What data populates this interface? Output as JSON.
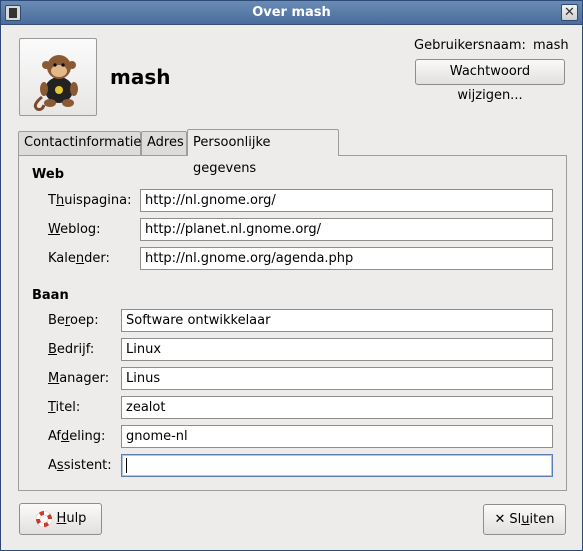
{
  "window": {
    "title": "Over mash"
  },
  "header": {
    "display_name": "mash",
    "username_label": "Gebruikersnaam:",
    "username_value": "mash",
    "change_password_label": "Wachtwoord wijzigen..."
  },
  "tabs": [
    {
      "label": "Contactinformatie",
      "active": false
    },
    {
      "label": "Adres",
      "active": false
    },
    {
      "label": "Persoonlijke gegevens",
      "active": true
    }
  ],
  "web": {
    "section_title": "Web",
    "fields": [
      {
        "pre": "T",
        "u": "h",
        "post": "uispagina:",
        "value": "http://nl.gnome.org/"
      },
      {
        "pre": "",
        "u": "W",
        "post": "eblog:",
        "value": "http://planet.nl.gnome.org/"
      },
      {
        "pre": "Kale",
        "u": "n",
        "post": "der:",
        "value": "http://nl.gnome.org/agenda.php"
      }
    ]
  },
  "job": {
    "section_title": "Baan",
    "fields": [
      {
        "pre": "Be",
        "u": "r",
        "post": "oep:",
        "value": "Software ontwikkelaar"
      },
      {
        "pre": "",
        "u": "B",
        "post": "edrijf:",
        "value": "Linux"
      },
      {
        "pre": "",
        "u": "M",
        "post": "anager:",
        "value": "Linus"
      },
      {
        "pre": "",
        "u": "T",
        "post": "itel:",
        "value": "zealot"
      },
      {
        "pre": "Af",
        "u": "d",
        "post": "eling:",
        "value": "gnome-nl"
      },
      {
        "pre": "A",
        "u": "s",
        "post": "sistent:",
        "value": ""
      }
    ]
  },
  "footer": {
    "help": {
      "pre": "",
      "u": "H",
      "post": "ulp"
    },
    "close": {
      "pre": "Sl",
      "u": "u",
      "post": "iten"
    }
  },
  "colors": {
    "titlebar": "#4a6d9c",
    "window_bg": "#edeceb",
    "focus": "#5a7fb3"
  }
}
